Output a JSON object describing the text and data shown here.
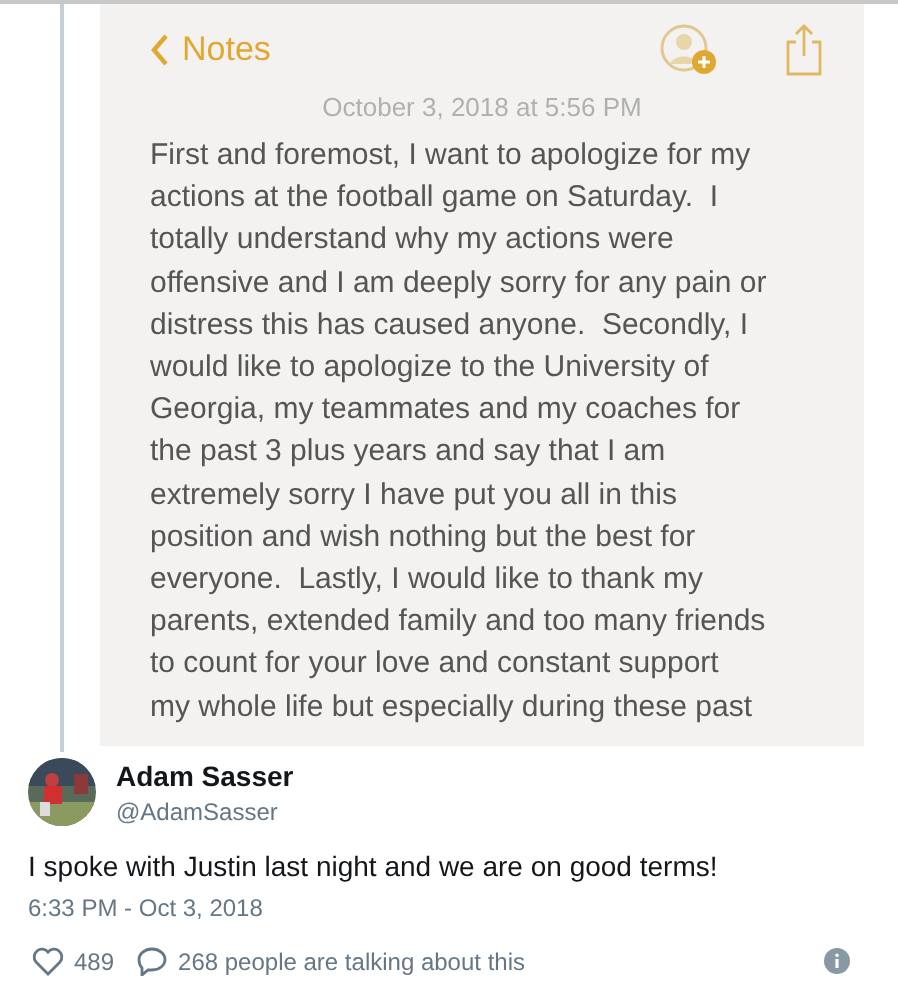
{
  "embedded_screenshot": {
    "back_label": "Notes",
    "date": "October 3, 2018 at 5:56 PM",
    "body_lines": [
      "First and foremost, I want to apologize for my",
      "actions at the football game on Saturday.  I",
      "totally understand why my actions were",
      "offensive and I am deeply sorry for any pain or",
      "distress this has caused anyone.  Secondly, I",
      "would like to apologize to the University of",
      "Georgia, my teammates and my coaches for",
      "the past 3 plus years and say that I am",
      "extremely sorry I have put you all in this",
      "position and wish nothing but the best for",
      "everyone.  Lastly, I would like to thank my",
      "parents, extended family and too many friends",
      "to count for your love and constant support",
      "my whole life but especially during these past"
    ]
  },
  "tweet": {
    "author": {
      "name": "Adam Sasser",
      "handle": "@AdamSasser"
    },
    "text": "I spoke with Justin last night and we are on good terms!",
    "time": "6:33 PM - Oct 3, 2018",
    "likes": "489",
    "talking": "268 people are talking about this"
  }
}
